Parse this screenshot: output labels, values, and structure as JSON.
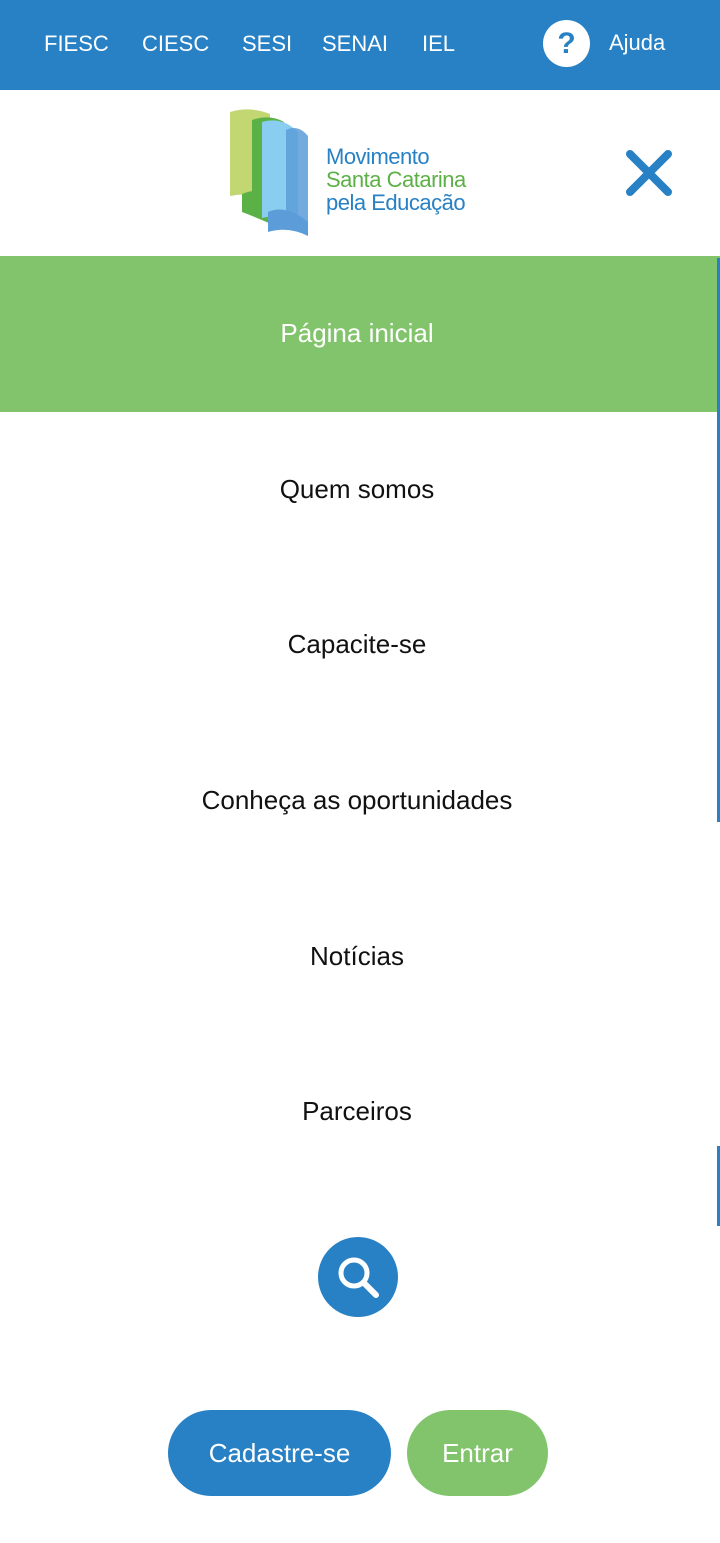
{
  "top_bar": {
    "links": [
      {
        "label": "FIESC"
      },
      {
        "label": "CIESC"
      },
      {
        "label": "SESI"
      },
      {
        "label": "SENAI"
      },
      {
        "label": "IEL"
      }
    ],
    "help_icon": "question-icon",
    "help_label": "Ajuda"
  },
  "header": {
    "logo": {
      "line1": "Movimento",
      "line2": "Santa Catarina",
      "line3": "pela Educação"
    },
    "close_icon": "close-icon"
  },
  "nav": {
    "items": [
      {
        "label": "Página inicial",
        "active": true
      },
      {
        "label": "Quem somos",
        "active": false
      },
      {
        "label": "Capacite-se",
        "active": false
      },
      {
        "label": "Conheça as oportunidades",
        "active": false
      },
      {
        "label": "Notícias",
        "active": false
      },
      {
        "label": "Parceiros",
        "active": false
      }
    ]
  },
  "search": {
    "icon": "search-icon"
  },
  "actions": {
    "register_label": "Cadastre-se",
    "login_label": "Entrar"
  },
  "colors": {
    "primary_blue": "#2781c4",
    "accent_green": "#82c46c",
    "text_dark": "#111111"
  }
}
